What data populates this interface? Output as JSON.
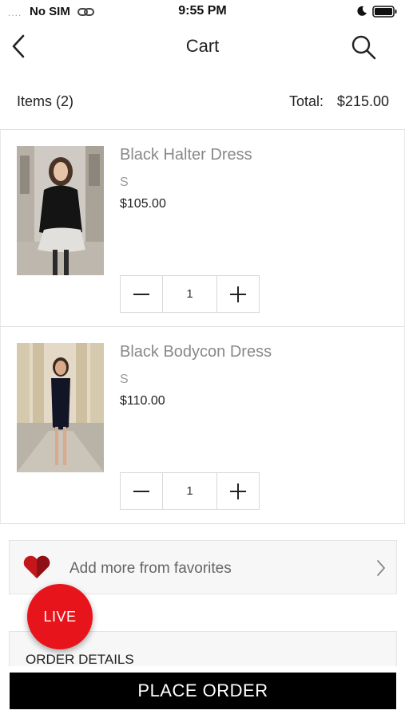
{
  "status_bar": {
    "signal": "....",
    "carrier": "No SIM",
    "time": "9:55 PM"
  },
  "header": {
    "title": "Cart",
    "back_icon": "chevron-left-icon",
    "search_icon": "search-icon"
  },
  "summary": {
    "items_label": "Items (2)",
    "total_label": "Total:",
    "total_value": "$215.00"
  },
  "cart": {
    "items": [
      {
        "name": "Black Halter Dress",
        "size": "S",
        "price": "$105.00",
        "quantity": "1"
      },
      {
        "name": "Black Bodycon Dress",
        "size": "S",
        "price": "$110.00",
        "quantity": "1"
      }
    ]
  },
  "favorites": {
    "label": "Add more from favorites",
    "icon": "heart-icon"
  },
  "live_button": {
    "label": "LIVE",
    "color": "#e8141c"
  },
  "order_details": {
    "label": "ORDER DETAILS"
  },
  "place_order": {
    "label": "PLACE ORDER"
  }
}
